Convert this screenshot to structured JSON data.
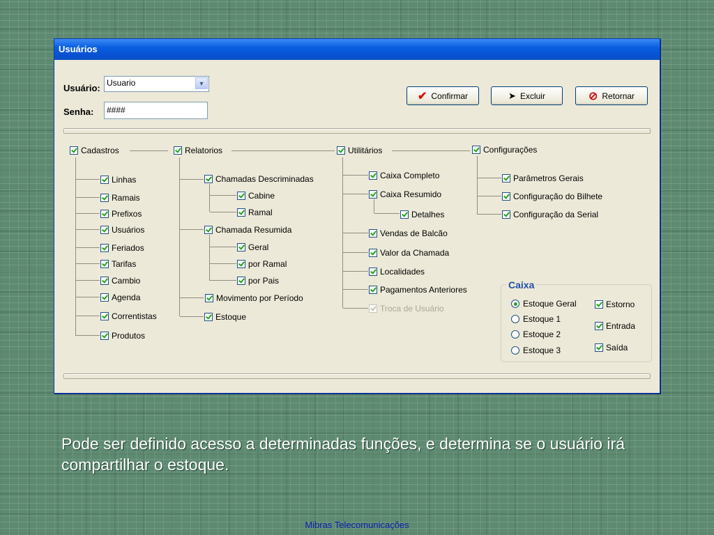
{
  "dialog": {
    "title": "Usuários",
    "user_label": "Usuário:",
    "user_value": "Usuario",
    "password_label": "Senha:",
    "password_value": "####",
    "buttons": {
      "confirm": "Confirmar",
      "delete": "Excluir",
      "back": "Retornar"
    }
  },
  "groups": {
    "cadastros": {
      "label": "Cadastros",
      "items": [
        "Linhas",
        "Ramais",
        "Prefixos",
        "Usuários",
        "Feriados",
        "Tarifas",
        "Cambio",
        "Agenda",
        "Correntistas",
        "Produtos"
      ]
    },
    "relatorios": {
      "label": "Relatorios",
      "chamadas_descriminadas": "Chamadas Descriminadas",
      "cabine": "Cabine",
      "ramal": "Ramal",
      "chamada_resumida": "Chamada Resumida",
      "geral": "Geral",
      "por_ramal": "por Ramal",
      "por_pais": "por Pais",
      "movimento": "Movimento por Período",
      "estoque": "Estoque"
    },
    "utilitarios": {
      "label": "Utilitários",
      "caixa_completo": "Caixa Completo",
      "caixa_resumido": "Caixa Resumido",
      "detalhes": "Detalhes",
      "vendas_balcao": "Vendas de Balcão",
      "valor_chamada": "Valor da Chamada",
      "localidades": "Localidades",
      "pagamentos_anteriores": "Pagamentos Anteriores",
      "troca_usuario": "Troca de Usuário"
    },
    "configuracoes": {
      "label": "Configurações",
      "parametros_gerais": "Parâmetros Gerais",
      "config_bilhete": "Configuração do Bilhete",
      "config_serial": "Configuração da Serial"
    }
  },
  "caixa": {
    "title": "Caixa",
    "radios": [
      "Estoque Geral",
      "Estoque 1",
      "Estoque 2",
      "Estoque 3"
    ],
    "selected": "Estoque Geral",
    "checks": [
      "Estorno",
      "Entrada",
      "Saída"
    ]
  },
  "caption": "Pode ser definido acesso a determinadas funções,  e  determina  se o usuário irá compartilhar o estoque.",
  "footer": "Mibras Telecomunicações",
  "colors": {
    "title_bar": "#0a5fe0",
    "check": "#21a121",
    "caixa_title": "#1f4fa6",
    "footer_text": "#0e1fb0"
  }
}
